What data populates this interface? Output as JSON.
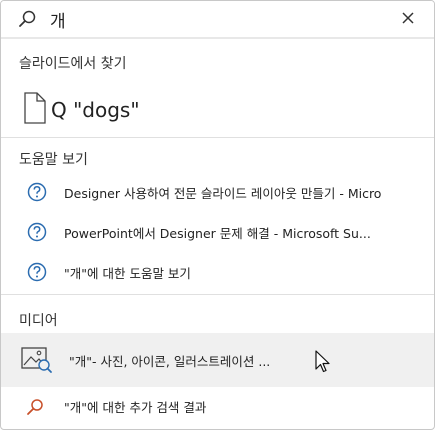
{
  "search": {
    "query": "개"
  },
  "find_section": {
    "title": "슬라이드에서 찾기",
    "item": {
      "text": "\"dogs\""
    }
  },
  "help_section": {
    "title": "도움말 보기",
    "items": [
      {
        "text": "Designer 사용하여 전문 슬라이드 레이아웃 만들기 - Micro"
      },
      {
        "text": "PowerPoint에서 Designer 문제 해결 - Microsoft Su..."
      },
      {
        "text": "\"개\"에 대한 도움말 보기"
      }
    ]
  },
  "media_section": {
    "title": "미디어",
    "item": {
      "text": "\"개\"- 사진, 아이콘, 일러스트레이션 ..."
    }
  },
  "more_results": {
    "text": "\"개\"에 대한 추가 검색 결과"
  },
  "colors": {
    "help_icon": "#2b6cb0",
    "search_accent": "#c8502a"
  }
}
